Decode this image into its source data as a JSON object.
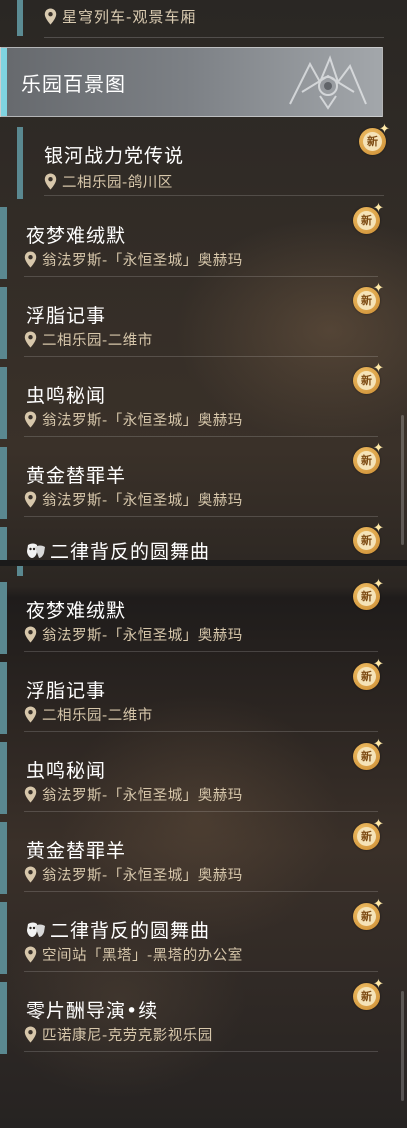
{
  "top_location": {
    "text": "星穹列车-观景车厢"
  },
  "category": {
    "title": "乐园百景图"
  },
  "top_entries": [
    {
      "name": "银河战力党传说",
      "location": "二相乐园-鸽川区",
      "badge": "新"
    },
    {
      "name": "夜梦难绒默",
      "location": "翁法罗斯-「永恒圣城」奥赫玛",
      "badge": "新"
    },
    {
      "name": "浮脂记事",
      "location": "二相乐园-二维市",
      "badge": "新"
    },
    {
      "name": "虫鸣秘闻",
      "location": "翁法罗斯-「永恒圣城」奥赫玛",
      "badge": "新"
    },
    {
      "name": "黄金替罪羊",
      "location": "翁法罗斯-「永恒圣城」奥赫玛",
      "badge": "新"
    },
    {
      "name": "二律背反的圆舞曲",
      "location": "",
      "badge": "新"
    }
  ],
  "bottom_entries": [
    {
      "name": "夜梦难绒默",
      "location": "翁法罗斯-「永恒圣城」奥赫玛",
      "badge": "新"
    },
    {
      "name": "浮脂记事",
      "location": "二相乐园-二维市",
      "badge": "新"
    },
    {
      "name": "虫鸣秘闻",
      "location": "翁法罗斯-「永恒圣城」奥赫玛",
      "badge": "新"
    },
    {
      "name": "黄金替罪羊",
      "location": "翁法罗斯-「永恒圣城」奥赫玛",
      "badge": "新"
    },
    {
      "name": "二律背反的圆舞曲",
      "location": "空间站「黑塔」-黑塔的办公室",
      "badge": "新"
    },
    {
      "name": "零片酬导演•续",
      "location": "匹诺康尼-克劳克影视乐园",
      "badge": "新"
    }
  ],
  "icons": {
    "location": "location-pin-icon",
    "mask": "theater-mask-icon",
    "new": "new-badge-icon",
    "emblem": "crest-emblem-icon"
  },
  "colors": {
    "accent_bar": "#5a8890",
    "header_accent": "#7fd3e0",
    "location_text": "#d7c7ab",
    "badge_gold": "#e0a448"
  }
}
